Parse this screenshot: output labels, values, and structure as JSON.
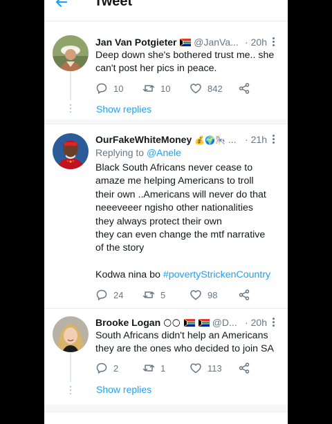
{
  "header": {
    "title": "Tweet"
  },
  "tweets": [
    {
      "name": "Jan Van Potgieter",
      "handle": "@JanVa...",
      "time": "· 20h",
      "lines": [
        "Deep down she's bothered trust me.. she",
        "can't post her pics in peace."
      ],
      "replies": "10",
      "retweets": "10",
      "likes": "842",
      "show_replies": "Show replies"
    },
    {
      "name": "OurFakeWhiteMoney",
      "handle": "...",
      "time": "· 21h",
      "replying_label": "Replying to",
      "replying_handle": "@Anele",
      "lines": [
        "Black South Africans never cease to",
        "amaze me  helping Americans to troll",
        "their own  ..Americans will never do that",
        "neeeveeer  ngisho other nationalities",
        "they always protect their own",
        "they can even change the mtf narrative",
        "of the story",
        ""
      ],
      "last_line_text": "Kodwa nina  bo ",
      "hashtag": "#povertyStrickenCountry",
      "replies": "24",
      "retweets": "5",
      "likes": "98"
    },
    {
      "name": "Brooke Logan",
      "handle": "@D...",
      "time": "· 20h",
      "lines": [
        "South Africans didn't help an Americans",
        "they are the ones who decided to join SA"
      ],
      "replies": "2",
      "retweets": "1",
      "likes": "113",
      "show_replies": "Show replies"
    }
  ],
  "icons": [
    "back-arrow-icon",
    "more-icon",
    "reply-icon",
    "retweet-icon",
    "like-icon",
    "share-icon",
    "south-africa-flag-icon",
    "money-bag-emoji",
    "globe-emoji",
    "carousel-emoji",
    "sparkle-emoji"
  ],
  "colors": {
    "accent": "#1da1f2",
    "text": "#14171a",
    "secondary": "#657786",
    "divider": "#e6ecf0",
    "background": "#ffffff"
  }
}
